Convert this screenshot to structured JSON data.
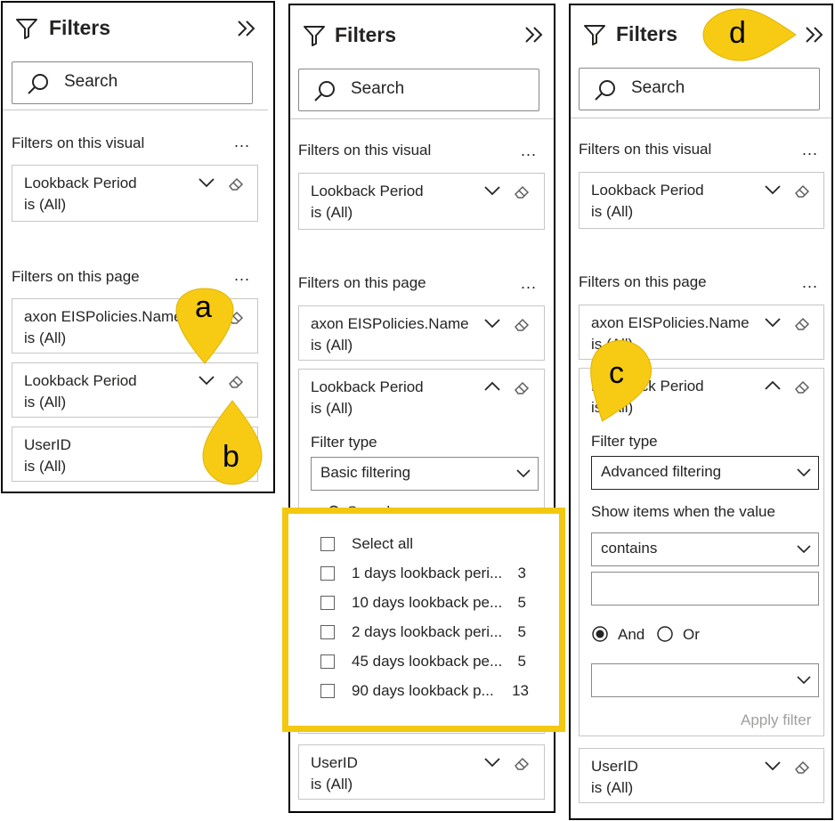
{
  "panels": [
    {
      "title": "Filters",
      "search_placeholder": "Search",
      "visual_section": "Filters on this visual",
      "page_section": "Filters on this page",
      "more": "...",
      "cards": [
        {
          "field": "Lookback Period",
          "state": "is (All)"
        },
        {
          "field": "axon EISPolicies.Name",
          "state": "is (All)"
        },
        {
          "field": "Lookback Period",
          "state": "is (All)"
        },
        {
          "field": "UserID",
          "state": "is (All)"
        }
      ]
    },
    {
      "title": "Filters",
      "search_placeholder": "Search",
      "visual_section": "Filters on this visual",
      "page_section": "Filters on this page",
      "more": "...",
      "cards": [
        {
          "field": "Lookback Period",
          "state": "is (All)"
        },
        {
          "field": "axon EISPolicies.Name",
          "state": "is (All)"
        },
        {
          "field": "Lookback Period",
          "state": "is (All)"
        },
        {
          "field": "UserID",
          "state": "is (All)"
        }
      ],
      "filter_type_label": "Filter type",
      "filter_type_value": "Basic filtering",
      "inner_search": "Search",
      "select_all": "Select all",
      "items": [
        {
          "label": "1 days lookback peri...",
          "count": "3"
        },
        {
          "label": "10 days lookback pe...",
          "count": "5"
        },
        {
          "label": "2 days lookback peri...",
          "count": "5"
        },
        {
          "label": "45 days lookback pe...",
          "count": "5"
        },
        {
          "label": "90 days lookback p...",
          "count": "13"
        }
      ]
    },
    {
      "title": "Filters",
      "search_placeholder": "Search",
      "visual_section": "Filters on this visual",
      "page_section": "Filters on this page",
      "more": "...",
      "cards": [
        {
          "field": "Lookback Period",
          "state": "is (All)"
        },
        {
          "field": "axon EISPolicies.Name",
          "state": "is (All)"
        },
        {
          "field": "Lookback Period",
          "state": "is (All)"
        },
        {
          "field": "UserID",
          "state": "is (All)"
        }
      ],
      "filter_type_label": "Filter type",
      "filter_type_value": "Advanced filtering",
      "show_items_label": "Show items when the value",
      "condition_value": "contains",
      "condition_text": "",
      "logic_and": "And",
      "logic_or": "Or",
      "second_condition": "",
      "apply": "Apply filter"
    }
  ],
  "callouts": {
    "a": "a",
    "b": "b",
    "c": "c",
    "d": "d"
  },
  "colors": {
    "callout": "#f7cb13",
    "highlight": "#f2c811",
    "border": "#000000"
  }
}
